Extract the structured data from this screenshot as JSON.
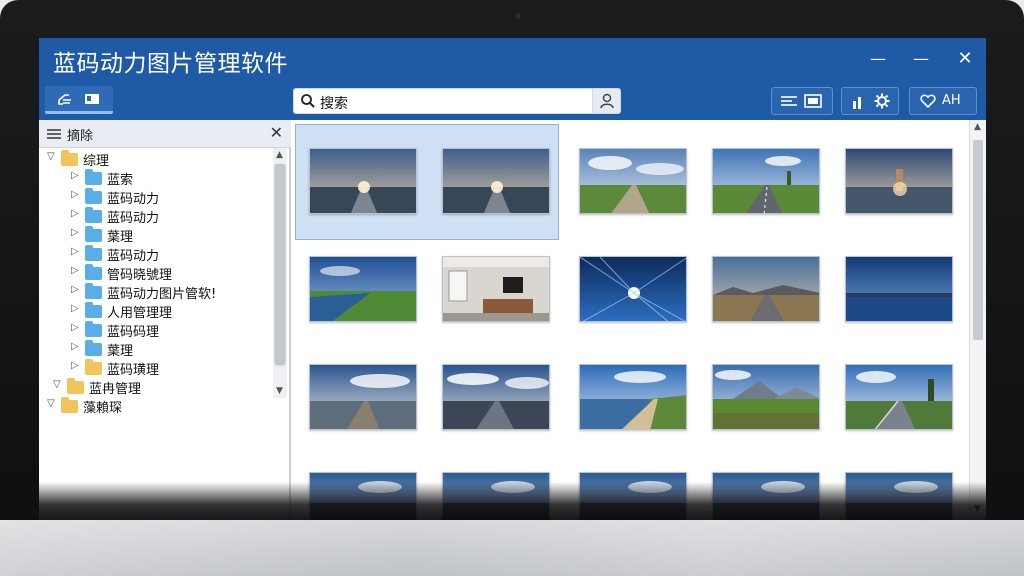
{
  "window": {
    "title": "蓝码动力图片管理软件",
    "controls": {
      "minimize": "—",
      "restore": "—",
      "close": "✕"
    }
  },
  "toolbar": {
    "search": {
      "value": "搜索"
    },
    "right_group_3_label": "AH"
  },
  "sidebar": {
    "title": "摘除",
    "close": "✕",
    "tree": [
      {
        "label": "综理",
        "level": 0,
        "expanded": true,
        "color": "yellow"
      },
      {
        "label": "蓝索",
        "level": 1,
        "color": "blue"
      },
      {
        "label": "蓝码动力",
        "level": 1,
        "color": "blue"
      },
      {
        "label": "蓝码动力",
        "level": 1,
        "color": "blue"
      },
      {
        "label": "葉理",
        "level": 1,
        "color": "blue"
      },
      {
        "label": "蓝码动力",
        "level": 1,
        "color": "blue"
      },
      {
        "label": "管码晓號理",
        "level": 1,
        "color": "blue"
      },
      {
        "label": "蓝码动力图片管软!",
        "level": 1,
        "color": "blue"
      },
      {
        "label": "人用管理理",
        "level": 1,
        "color": "blue"
      },
      {
        "label": "蓝码码理",
        "level": 1,
        "color": "blue"
      },
      {
        "label": "葉理",
        "level": 1,
        "color": "blue"
      },
      {
        "label": "蓝码璜理",
        "level": 1,
        "color": "yellow"
      },
      {
        "label": "蓝冉管理",
        "level": 0,
        "expanded": true,
        "color": "yellow"
      },
      {
        "label": "藻賴琛",
        "level": -1,
        "expanded": true,
        "color": "yellow"
      }
    ]
  },
  "gallery": {
    "items": [
      {
        "kind": "road-sunset"
      },
      {
        "kind": "road-sunset"
      },
      {
        "kind": "road-field"
      },
      {
        "kind": "road-trees"
      },
      {
        "kind": "lake-statue"
      },
      {
        "kind": "lake-river"
      },
      {
        "kind": "office"
      },
      {
        "kind": "light-tunnel"
      },
      {
        "kind": "road-hills"
      },
      {
        "kind": "lake-dusk"
      },
      {
        "kind": "pier-clouds"
      },
      {
        "kind": "road-clouds"
      },
      {
        "kind": "coast-path"
      },
      {
        "kind": "mountain-field"
      },
      {
        "kind": "road-rail"
      },
      {
        "kind": "partial"
      },
      {
        "kind": "partial"
      },
      {
        "kind": "partial"
      },
      {
        "kind": "partial"
      },
      {
        "kind": "partial"
      }
    ],
    "selected": [
      0,
      1
    ]
  },
  "colors": {
    "titlebar": "#1f5aa6",
    "selection": "#cfe0f5",
    "folder_yellow": "#f3c45a",
    "folder_blue": "#5aaee8"
  }
}
